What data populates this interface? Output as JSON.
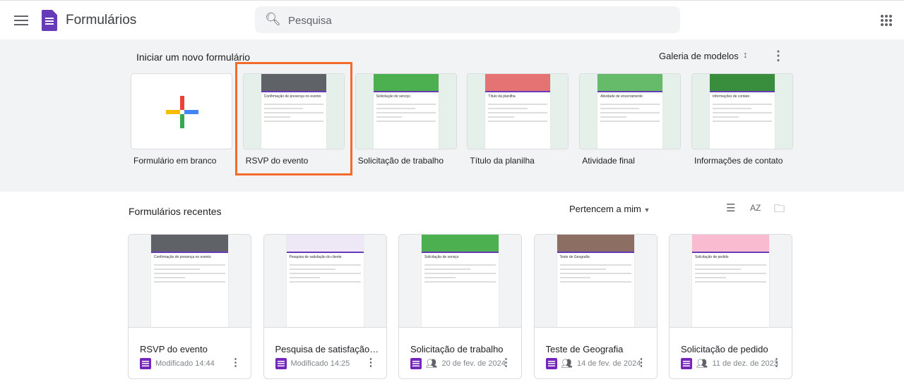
{
  "header": {
    "app_title": "Formulários",
    "search_placeholder": "Pesquisa"
  },
  "gallery": {
    "title": "Iniciar um novo formulário",
    "gallery_link": "Galeria de modelos",
    "templates": [
      {
        "label": "Formulário em branco"
      },
      {
        "label": "RSVP do evento",
        "preview_title": "Confirmação de presença no evento",
        "color": "#5f6368"
      },
      {
        "label": "Solicitação de trabalho",
        "preview_title": "Solicitação de serviço",
        "color": "#4caf50"
      },
      {
        "label": "Título da planilha",
        "preview_title": "Título da planilha",
        "color": "#e57373"
      },
      {
        "label": "Atividade final",
        "preview_title": "Atividade de encerramento",
        "color": "#66bb6a"
      },
      {
        "label": "Informações de contato",
        "preview_title": "Informações de contato",
        "color": "#388e3c"
      }
    ]
  },
  "recent": {
    "title": "Formulários recentes",
    "owner_filter": "Pertencem a mim",
    "forms": [
      {
        "name": "RSVP do evento",
        "meta": "Modificado 14:44",
        "shared": false,
        "preview_title": "Confirmação de presença no evento",
        "color": "#5f6368"
      },
      {
        "name": "Pesquisa de satisfação do cliente",
        "meta": "Modificado 14:25",
        "shared": false,
        "preview_title": "Pesquisa de satisfação do cliente",
        "color": "#ede7f6"
      },
      {
        "name": "Solicitação de trabalho",
        "meta": "20 de fev. de 2024",
        "shared": true,
        "preview_title": "Solicitação de serviço",
        "color": "#4caf50"
      },
      {
        "name": "Teste de Geografia",
        "meta": "14 de fev. de 2024",
        "shared": true,
        "preview_title": "Teste de Geografia",
        "color": "#8d6e63"
      },
      {
        "name": "Solicitação de pedido",
        "meta": "11 de dez. de 2023",
        "shared": true,
        "preview_title": "Solicitação de pedido",
        "color": "#f8bbd0"
      }
    ]
  }
}
